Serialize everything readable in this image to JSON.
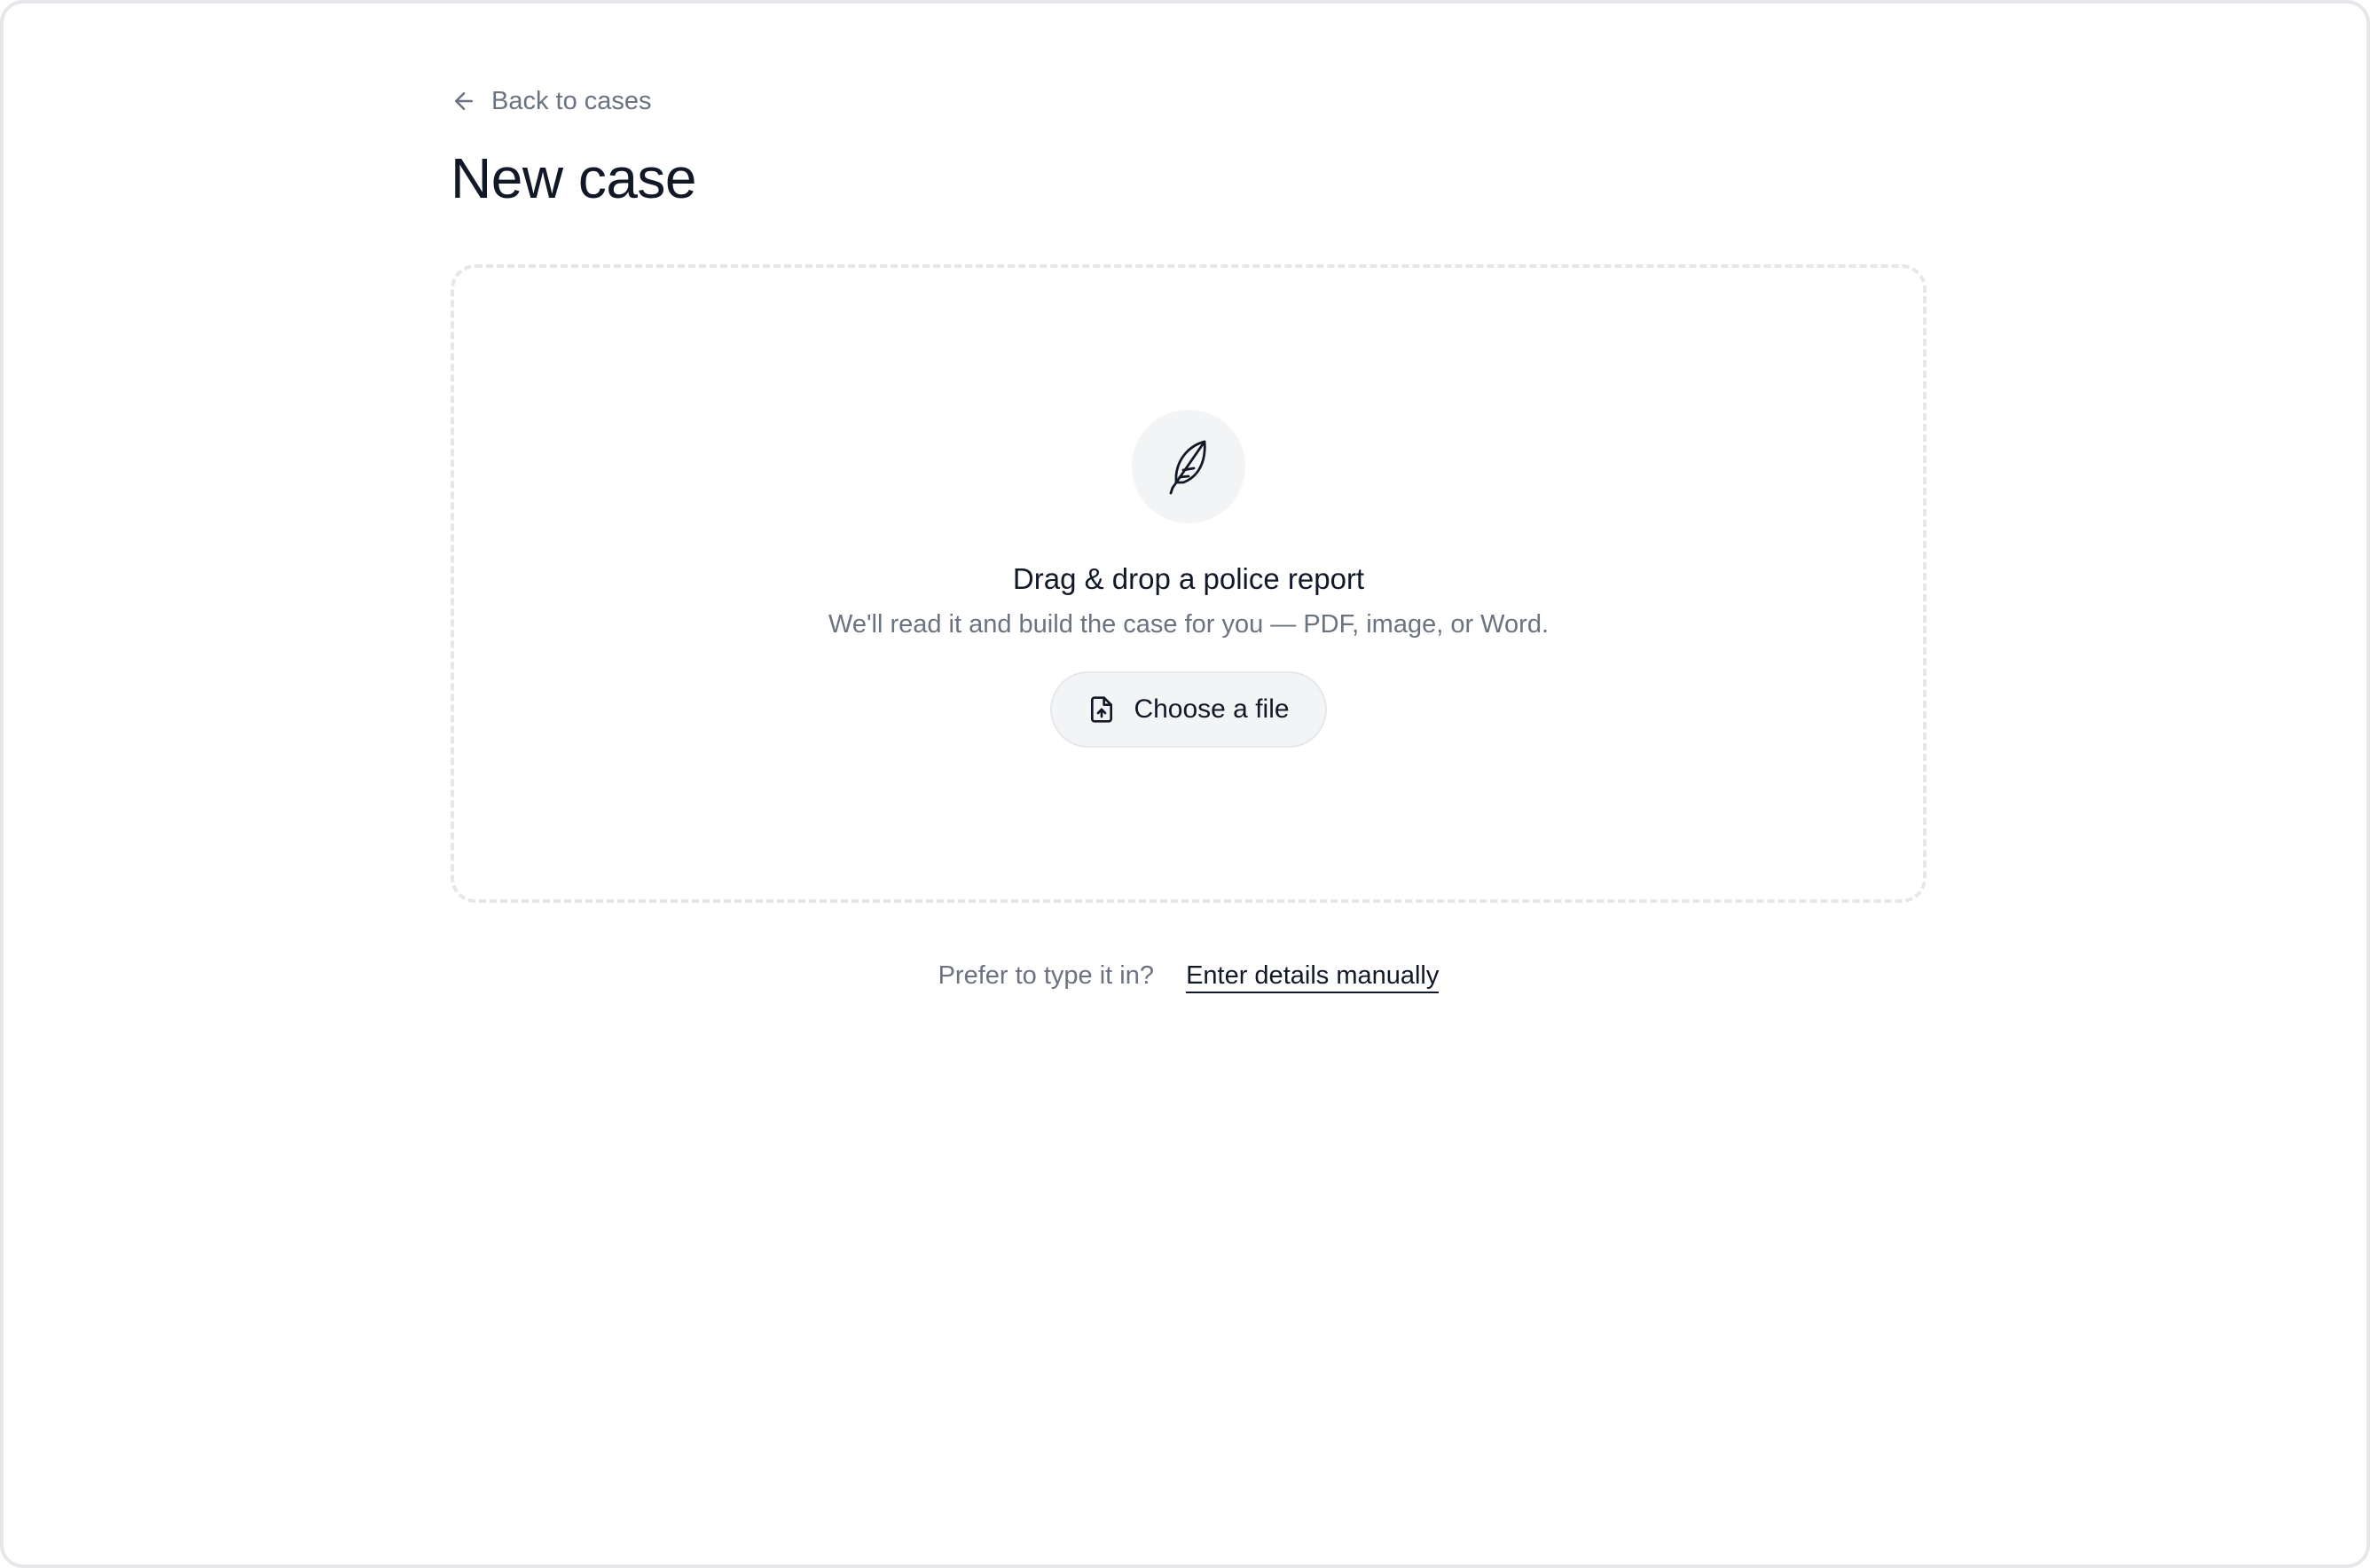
{
  "nav": {
    "back_label": "Back to cases",
    "back_icon": "arrow-left-icon"
  },
  "page": {
    "title": "New case"
  },
  "dropzone": {
    "icon": "feather-icon",
    "heading": "Drag & drop a police report",
    "subtext": "We'll read it and build the case for you — PDF, image, or Word.",
    "choose_button_label": "Choose a file",
    "choose_button_icon": "file-upload-icon"
  },
  "manual": {
    "prompt": "Prefer to type it in?",
    "link_label": "Enter details manually"
  },
  "colors": {
    "text_primary": "#111827",
    "text_muted": "#6b7280",
    "border": "#e5e7eb",
    "surface": "#f3f4f6",
    "background": "#ffffff"
  }
}
